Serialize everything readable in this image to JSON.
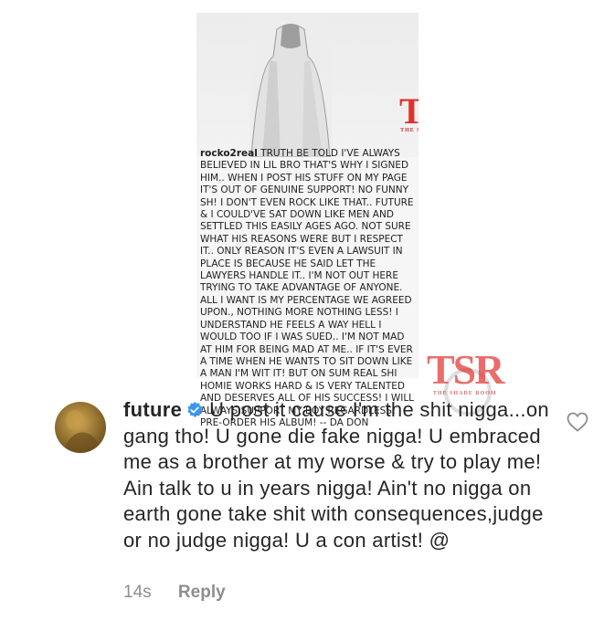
{
  "post": {
    "username": "rocko2real",
    "caption": "TRUTH BE TOLD I'VE ALWAYS BELIEVED IN LIL BRO THAT'S WHY I SIGNED HIM.. WHEN I POST HIS STUFF ON MY PAGE IT'S OUT OF GENUINE SUPPORT! NO FUNNY SH! I DON'T EVEN ROCK LIKE THAT.. FUTURE & I COULD'VE SAT DOWN LIKE MEN AND SETTLED THIS EASILY AGES AGO. NOT SURE WHAT HIS REASONS WERE BUT I RESPECT IT.. ONLY REASON IT'S EVEN A LAWSUIT IN PLACE IS BECAUSE HE SAID LET THE LAWYERS HANDLE IT.. I'M NOT OUT HERE TRYING TO TAKE ADVANTAGE OF ANYONE. ALL I WANT IS MY PERCENTAGE WE AGREED UPON., NOTHING MORE NOTHING LESS! I UNDERSTAND HE FEELS A WAY HELL I WOULD TOO IF I WAS SUED.. I'M NOT MAD AT HIM FOR BEING MAD AT ME.. IF IT'S EVER A TIME WHEN HE WANTS TO SIT DOWN LIKE A MAN I'M WIT IT! BUT ON SUM REAL SHI HOMIE WORKS HARD & IS VERY TALENTED AND DESERVES ALL OF HIS SUCCESS! I WILL ALWAYS SUPPORT MY BOY REGARDLESS!",
    "signoff": "PRE-ORDER HIS ALBUM! -- DA DON"
  },
  "watermark": {
    "logo": "TSR",
    "tagline": "THE SHADE ROOM",
    "color": "#e0312c"
  },
  "comment": {
    "username": "future",
    "verified_icon": "verified-badge-icon",
    "text": "U post it cause I'm the shit nigga...on gang tho! U gone die fake nigga! U embraced me as a brother at my worse & try to play me! Ain talk to u in years nigga! Ain't no nigga on earth gone take shit with consequences,judge or no judge nigga! U a con artist!  @",
    "timestamp": "14s",
    "reply_label": "Reply",
    "like_icon": "heart-icon"
  }
}
